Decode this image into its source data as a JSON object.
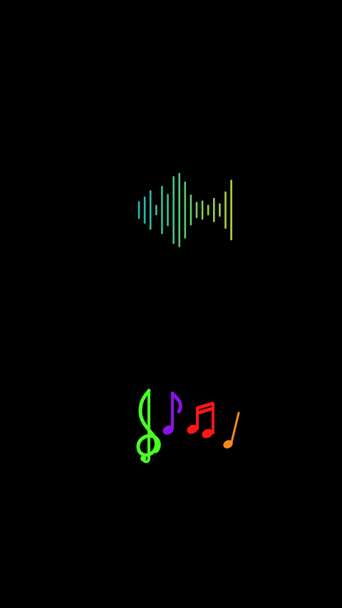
{
  "screen": {
    "background": "#000000"
  },
  "waveform": {
    "icon": "audio-waveform-icon",
    "levels": [
      0.22,
      0.35,
      0.52,
      0.12,
      0.64,
      0.42,
      0.91,
      1.0,
      0.76,
      0.4,
      0.2,
      0.24,
      0.12,
      0.31,
      0.16,
      0.49,
      0.81
    ],
    "colors": [
      "#25b8bf",
      "#3ec28a",
      "#8bd34e",
      "#c7cf3a"
    ]
  },
  "music_notes": {
    "items": [
      {
        "icon": "treble-clef-icon",
        "color": "#49ff24"
      },
      {
        "icon": "eighth-note-icon",
        "color": "#8b12e6"
      },
      {
        "icon": "beamed-sixteenth-notes-icon",
        "color": "#ff1616"
      },
      {
        "icon": "quarter-note-icon",
        "color": "#f28a20"
      }
    ]
  }
}
